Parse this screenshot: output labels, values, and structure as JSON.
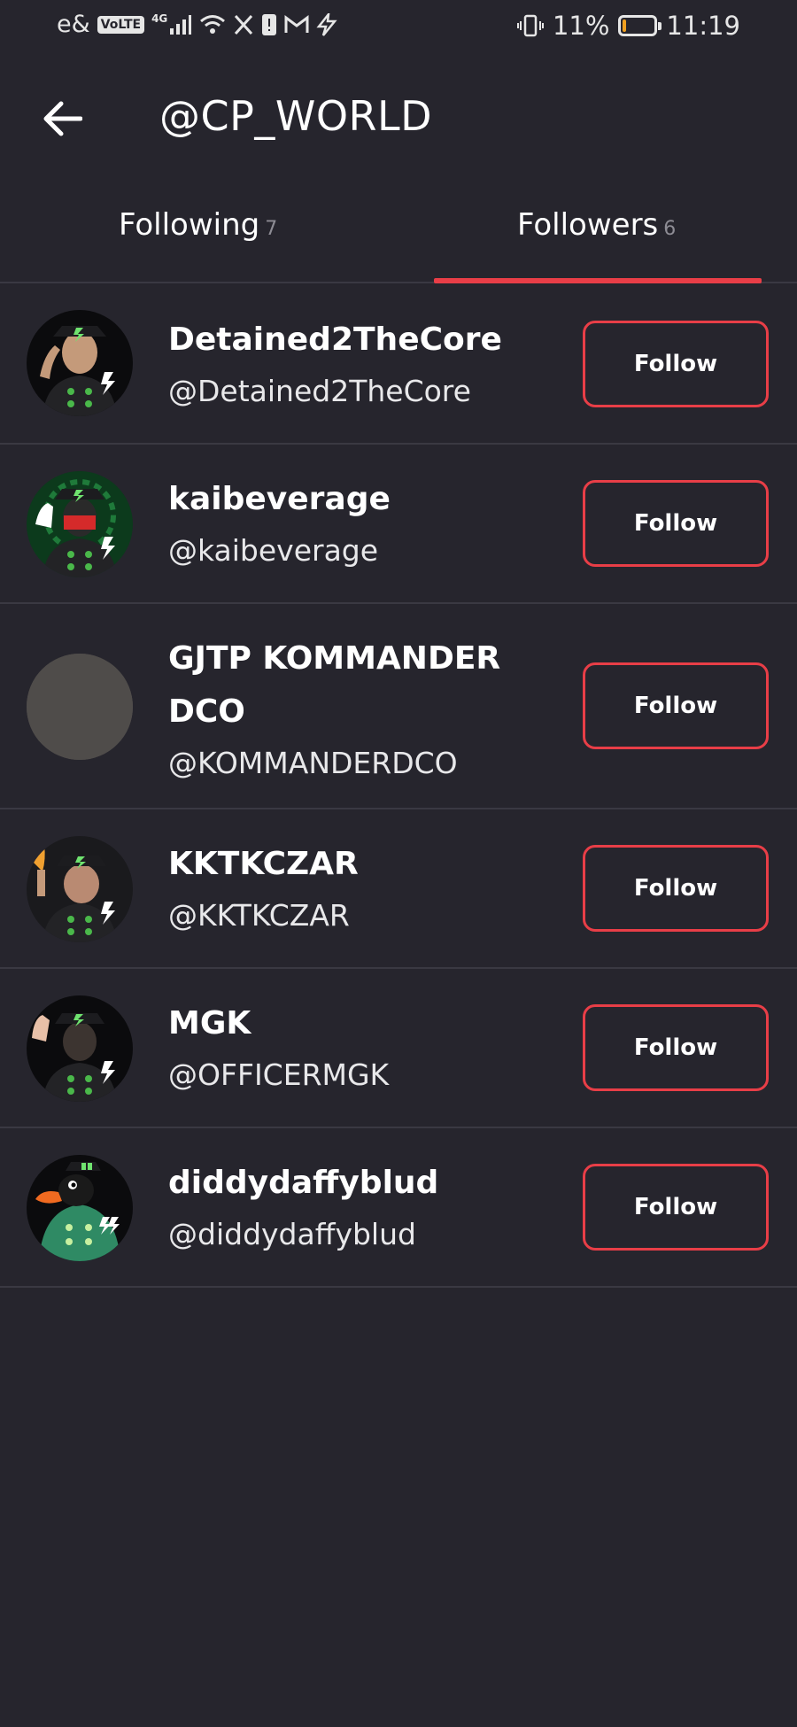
{
  "status_bar": {
    "carrier": "e&",
    "volte_badge": "VoLTE",
    "network_type": "4G",
    "battery_percent": "11%",
    "battery_level": 0.11,
    "battery_color": "#f0a020",
    "time": "11:19",
    "icons": [
      "signal-icon",
      "wifi-icon",
      "x-app-icon",
      "sim-alert-icon",
      "gmail-icon",
      "bolt-icon",
      "vibrate-icon",
      "battery-icon"
    ]
  },
  "header": {
    "back_icon": "arrow-left-icon",
    "title": "@CP_WORLD"
  },
  "tabs": [
    {
      "label": "Following",
      "count": "7",
      "active": false
    },
    {
      "label": "Followers",
      "count": "6",
      "active": true
    }
  ],
  "accent_color": "#e83e47",
  "followers": [
    {
      "name": "Detained2TheCore",
      "handle": "@Detained2TheCore",
      "button": "Follow",
      "avatar": "officer-avatar-saluting"
    },
    {
      "name": "kaibeverage",
      "handle": "@kaibeverage",
      "button": "Follow",
      "avatar": "officer-avatar-masked"
    },
    {
      "name": "GJTP KOMMANDER DCO",
      "handle": "@KOMMANDERDCO",
      "button": "Follow",
      "avatar": "placeholder-avatar"
    },
    {
      "name": "KKTKCZAR",
      "handle": "@KKTKCZAR",
      "button": "Follow",
      "avatar": "officer-avatar-torch"
    },
    {
      "name": "MGK",
      "handle": "@OFFICERMGK",
      "button": "Follow",
      "avatar": "officer-avatar-waving"
    },
    {
      "name": "diddydaffyblud",
      "handle": "@diddydaffyblud",
      "button": "Follow",
      "avatar": "duck-officer-avatar"
    }
  ]
}
